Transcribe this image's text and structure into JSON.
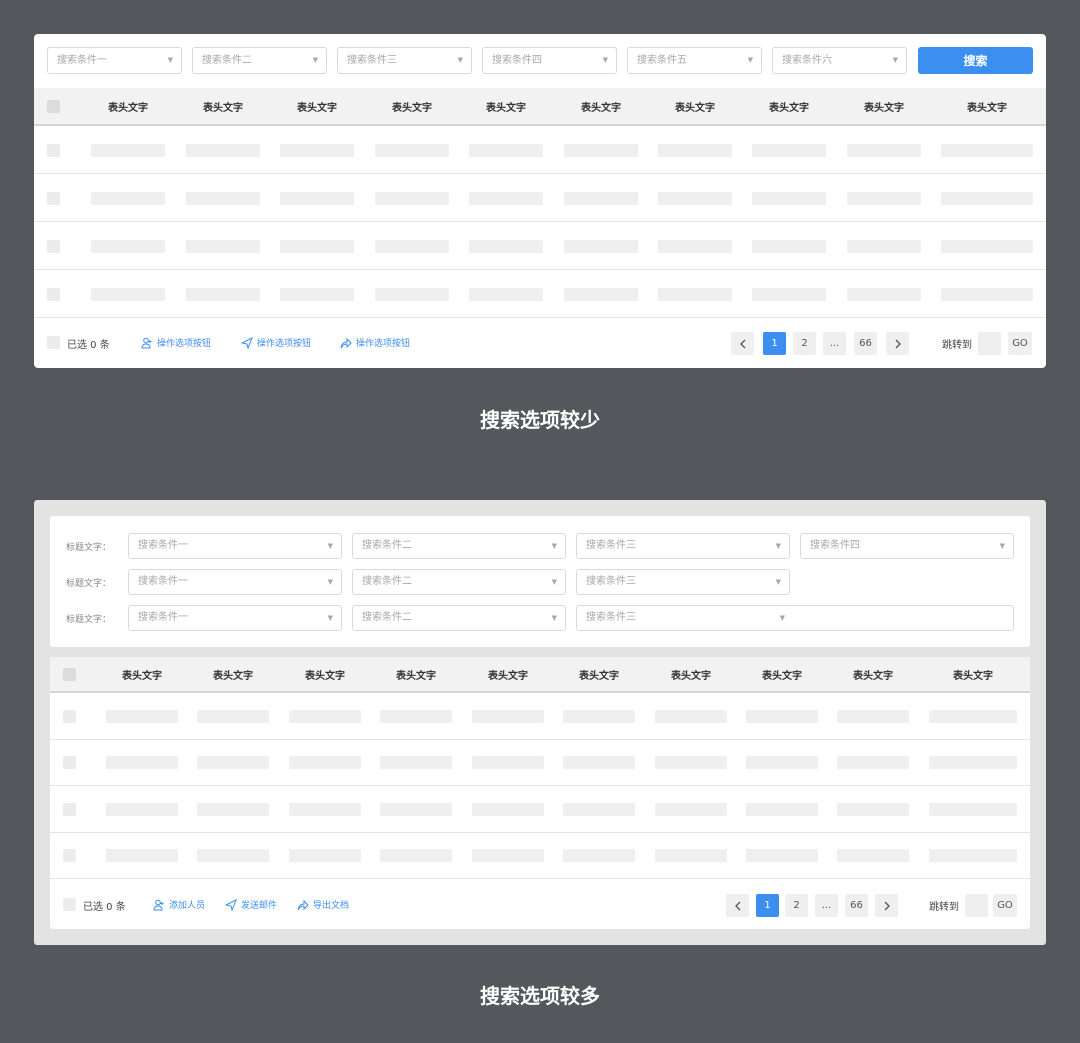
{
  "panel_small": {
    "selects": [
      {
        "placeholder": "搜索条件一"
      },
      {
        "placeholder": "搜索条件二"
      },
      {
        "placeholder": "搜索条件三"
      },
      {
        "placeholder": "搜索条件四"
      },
      {
        "placeholder": "搜索条件五"
      },
      {
        "placeholder": "搜索条件六"
      }
    ],
    "search_label": "搜索",
    "headers": [
      "表头文字",
      "表头文字",
      "表头文字",
      "表头文字",
      "表头文字",
      "表头文字",
      "表头文字",
      "表头文字",
      "表头文字",
      "表头文字"
    ],
    "row_count": 4,
    "footer": {
      "selected": "已选 0 条",
      "actions": [
        "操作选项按钮",
        "操作选项按钮",
        "操作选项按钮"
      ],
      "pages": [
        "1",
        "2",
        "...",
        "66"
      ],
      "current_page": "1",
      "jump_label": "跳转到",
      "go_label": "GO"
    },
    "caption": "搜索选项较少"
  },
  "panel_large": {
    "filter_rows": [
      {
        "label": "标题文字：",
        "selects": [
          "搜索条件一",
          "搜索条件二",
          "搜索条件三",
          "搜索条件四"
        ]
      },
      {
        "label": "标题文字：",
        "selects": [
          "搜索条件一",
          "搜索条件二",
          "搜索条件三"
        ]
      },
      {
        "label": "标题文字：",
        "selects": [
          "搜索条件一",
          "搜索条件二",
          "搜索条件三"
        ]
      }
    ],
    "headers": [
      "表头文字",
      "表头文字",
      "表头文字",
      "表头文字",
      "表头文字",
      "表头文字",
      "表头文字",
      "表头文字",
      "表头文字",
      "表头文字"
    ],
    "row_count": 4,
    "footer": {
      "selected": "已选 0 条",
      "actions": [
        "添加人员",
        "发送邮件",
        "导出文档"
      ],
      "pages": [
        "1",
        "2",
        "...",
        "66"
      ],
      "current_page": "1",
      "jump_label": "跳转到",
      "go_label": "GO"
    },
    "caption": "搜索选项较多"
  },
  "colors": {
    "background": "#54575c",
    "accent": "#3c8ff0",
    "header_bg": "#f2f2f2",
    "placeholder": "#efefef"
  }
}
